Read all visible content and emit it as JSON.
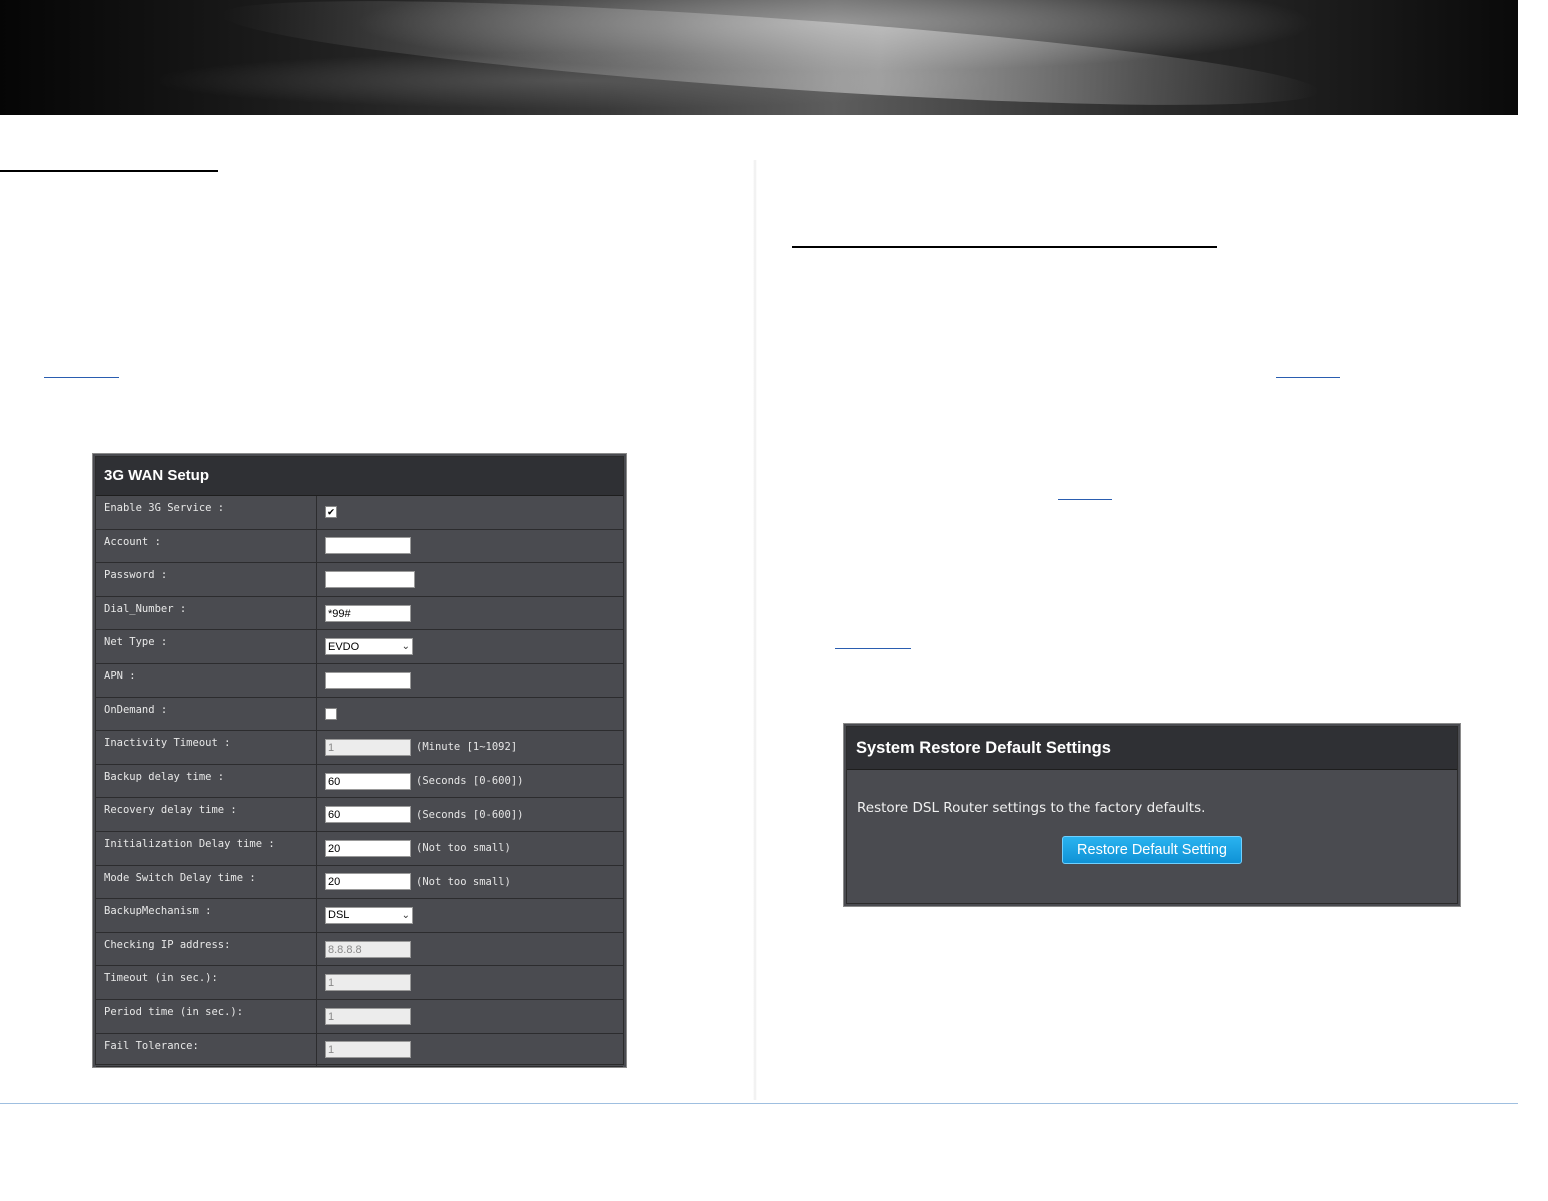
{
  "wan_setup": {
    "title": "3G WAN Setup",
    "rows": [
      {
        "label": "Enable 3G Service :",
        "type": "checkbox",
        "checked": true
      },
      {
        "label": "Account :",
        "type": "input",
        "value": ""
      },
      {
        "label": "Password :",
        "type": "input",
        "value": ""
      },
      {
        "label": "Dial_Number :",
        "type": "input",
        "value": "*99#"
      },
      {
        "label": "Net Type :",
        "type": "select",
        "value": "EVDO"
      },
      {
        "label": "APN :",
        "type": "input",
        "value": ""
      },
      {
        "label": "OnDemand :",
        "type": "checkbox",
        "checked": false
      },
      {
        "label": "Inactivity Timeout :",
        "type": "input",
        "value": "1",
        "disabled": true,
        "unit": "(Minute [1~1092]"
      },
      {
        "label": "Backup delay time :",
        "type": "input",
        "value": "60",
        "unit": "(Seconds [0-600])"
      },
      {
        "label": "Recovery delay time :",
        "type": "input",
        "value": "60",
        "unit": "(Seconds [0-600])"
      },
      {
        "label": "Initialization Delay time :",
        "type": "input",
        "value": "20",
        "unit": "(Not too small)"
      },
      {
        "label": "Mode Switch Delay time :",
        "type": "input",
        "value": "20",
        "unit": "(Not too small)"
      },
      {
        "label": "BackupMechanism :",
        "type": "select",
        "value": "DSL"
      },
      {
        "label": "Checking IP address:",
        "type": "input",
        "value": "8.8.8.8",
        "disabled": true
      },
      {
        "label": "Timeout (in sec.):",
        "type": "input",
        "value": "1",
        "disabled": true
      },
      {
        "label": "Period time (in sec.):",
        "type": "input",
        "value": "1",
        "disabled": true
      },
      {
        "label": "Fail Tolerance:",
        "type": "input",
        "value": "1",
        "disabled": true
      }
    ]
  },
  "restore": {
    "title": "System Restore Default Settings",
    "description": "Restore DSL Router settings to the factory defaults.",
    "button_label": "Restore Default Setting"
  },
  "colors": {
    "panel_bg": "#4a4b50",
    "panel_header": "#2f3034",
    "button_blue": "#1aa3e4",
    "link": "#2a5db0"
  }
}
